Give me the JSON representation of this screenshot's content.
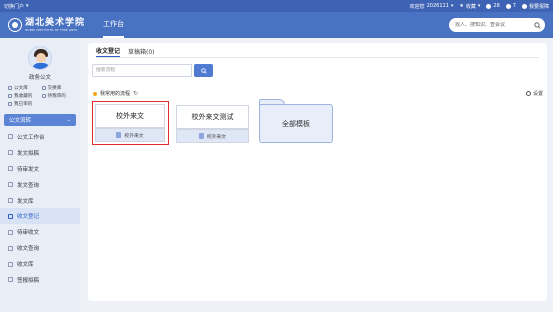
{
  "topbar": {
    "portal_label": "切换门户",
    "welcome": "欢迎您",
    "user_id": "2026111",
    "favorites": "收藏",
    "notifications_count": "28",
    "messages_count": "7",
    "report_issue": "我要报障"
  },
  "header": {
    "logo_cn": "湖北美术学院",
    "logo_en": "HUBEI INSTITUTE OF FINE ARTS",
    "workbench_tab": "工作台",
    "search_placeholder": "找人、搜知识、查会议"
  },
  "sidebar": {
    "profile_name": "政务公文",
    "quick_links": [
      "公文库",
      "交换库",
      "我收藏的",
      "待我审的",
      "我已审的"
    ],
    "menu_header": "公文流转",
    "items": [
      {
        "label": "公文工作台"
      },
      {
        "label": "发文拟稿"
      },
      {
        "label": "待审发文"
      },
      {
        "label": "发文查询"
      },
      {
        "label": "发文库"
      },
      {
        "label": "收文登记",
        "active": true
      },
      {
        "label": "待审收文"
      },
      {
        "label": "收文查询"
      },
      {
        "label": "收文库"
      },
      {
        "label": "签报拟稿"
      }
    ]
  },
  "main": {
    "tabs": [
      {
        "label": "收文登记",
        "active": true
      },
      {
        "label": "草稿箱(0)"
      }
    ],
    "search_placeholder": "搜索流程",
    "common_flows_label": "我常用的流程",
    "settings_label": "设置",
    "cards": [
      {
        "title": "校外来文",
        "sub": "校外来文"
      },
      {
        "title": "校外来文测试",
        "sub": "校外来文"
      }
    ],
    "all_templates": "全部模板"
  },
  "colors": {
    "top_strip": "#3f63b4",
    "header": "#4a72c2",
    "accent": "#2d5fc4",
    "selected_outline": "#e02b2b",
    "folder_fill": "#e7eef9"
  }
}
